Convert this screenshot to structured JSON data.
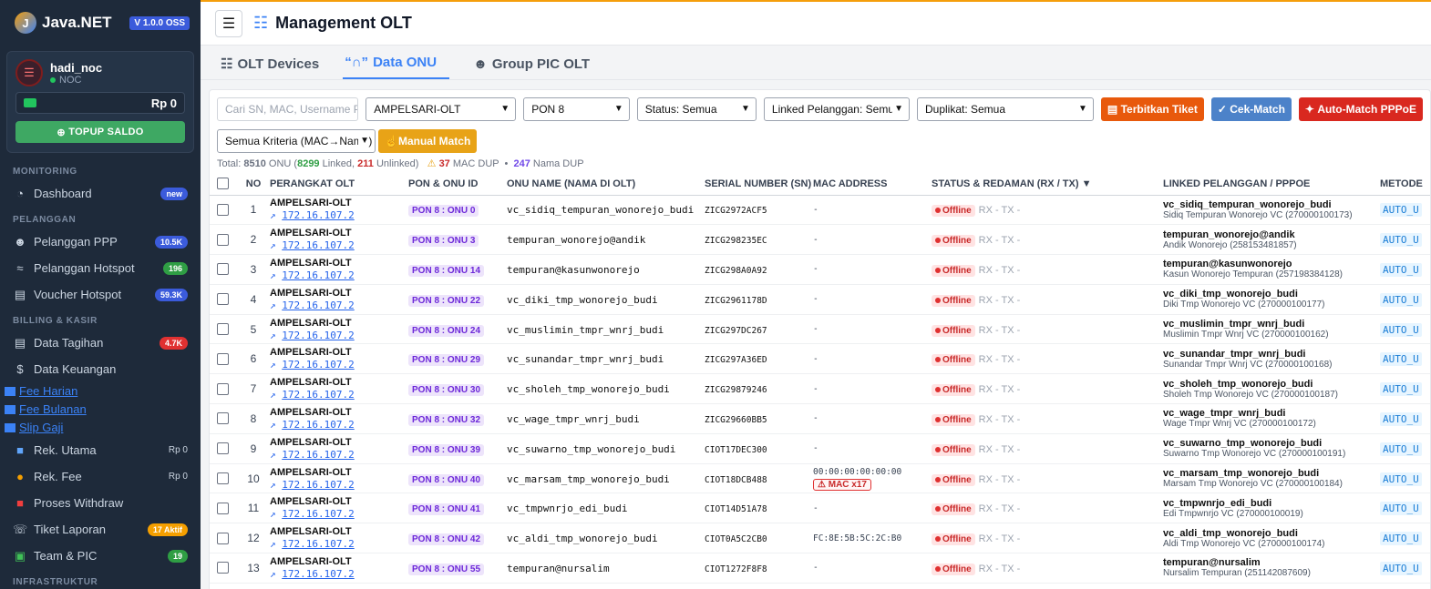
{
  "brand": {
    "name": "Java.NET",
    "version": "V 1.0.0 OSS"
  },
  "user": {
    "name": "hadi_noc",
    "role": "NOC",
    "saldo": "Rp 0",
    "topup_label": "TOPUP SALDO"
  },
  "sidebar": {
    "sections": {
      "monitoring": "MONITORING",
      "pelanggan": "PELANGGAN",
      "billing": "BILLING & KASIR",
      "infra": "INFRASTRUKTUR"
    },
    "items": {
      "dashboard": {
        "label": "Dashboard",
        "badge": "new"
      },
      "ppp": {
        "label": "Pelanggan PPP",
        "badge": "10.5K"
      },
      "hotspot": {
        "label": "Pelanggan Hotspot",
        "badge": "196"
      },
      "voucher": {
        "label": "Voucher Hotspot",
        "badge": "59.3K"
      },
      "tagihan": {
        "label": "Data Tagihan",
        "badge": "4.7K"
      },
      "keuangan": {
        "label": "Data Keuangan"
      },
      "fee_harian": {
        "label": "Fee Harian"
      },
      "fee_bulanan": {
        "label": "Fee Bulanan"
      },
      "slip_gaji": {
        "label": "Slip Gaji"
      },
      "rek_utama": {
        "label": "Rek. Utama",
        "badge": "Rp 0"
      },
      "rek_fee": {
        "label": "Rek. Fee",
        "badge": "Rp 0"
      },
      "withdraw": {
        "label": "Proses Withdraw"
      },
      "tiket": {
        "label": "Tiket Laporan",
        "badge": "17 Aktif"
      },
      "team": {
        "label": "Team & PIC",
        "badge": "19"
      }
    }
  },
  "header": {
    "title": "Management OLT"
  },
  "tabs": {
    "olt": "OLT Devices",
    "onu": "Data ONU",
    "group": "Group PIC OLT"
  },
  "filters": {
    "search_placeholder": "Cari SN, MAC, Username PPPoE",
    "olt": "AMPELSARI-OLT",
    "pon": "PON 8",
    "status": "Status: Semua",
    "linked": "Linked Pelanggan: Semua",
    "duplikat": "Duplikat: Semua",
    "kriteria": "Semua Kriteria (MAC→Nama)",
    "btn_tiket": "Terbitkan Tiket",
    "btn_cek": "Cek-Match",
    "btn_auto": "Auto-Match PPPoE",
    "btn_manual": "Manual Match"
  },
  "summary": {
    "total_label": "Total:",
    "total": "8510",
    "onu_word": "ONU (",
    "linked": "8299",
    "linked_word": "Linked,",
    "unlinked": "211",
    "unlinked_word": "Unlinked)",
    "mac_dup": "37",
    "mac_dup_word": "MAC DUP",
    "nama_dup": "247",
    "nama_dup_word": "Nama DUP"
  },
  "columns": {
    "no": "NO",
    "perangkat": "PERANGKAT OLT",
    "pon": "PON & ONU ID",
    "onu_name": "ONU NAME (NAMA DI OLT)",
    "sn": "SERIAL NUMBER (SN)",
    "mac": "MAC ADDRESS",
    "status": "STATUS & REDAMAN (RX / TX) ▼",
    "linked": "LINKED PELANGGAN / PPPOE",
    "metode": "METODE"
  },
  "rows": [
    {
      "no": "1",
      "olt": "AMPELSARI-OLT",
      "ip": "172.16.107.2",
      "pon": "PON 8 : ONU 0",
      "name": "vc_sidiq_tempuran_wonorejo_budi",
      "sn": "ZICG2972ACF5",
      "mac": "-",
      "dup": "",
      "status": "Offline",
      "rx": "RX -  TX -",
      "user": "vc_sidiq_tempuran_wonorejo_budi",
      "sub": "Sidiq Tempuran Wonorejo VC (270000100173)",
      "metode": "AUTO_U"
    },
    {
      "no": "2",
      "olt": "AMPELSARI-OLT",
      "ip": "172.16.107.2",
      "pon": "PON 8 : ONU 3",
      "name": "tempuran_wonorejo@andik",
      "sn": "ZICG298235EC",
      "mac": "-",
      "dup": "",
      "status": "Offline",
      "rx": "RX -  TX -",
      "user": "tempuran_wonorejo@andik",
      "sub": "Andik Wonorejo (258153481857)",
      "metode": "AUTO_U"
    },
    {
      "no": "3",
      "olt": "AMPELSARI-OLT",
      "ip": "172.16.107.2",
      "pon": "PON 8 : ONU 14",
      "name": "tempuran@kasunwonorejo",
      "sn": "ZICG298A0A92",
      "mac": "-",
      "dup": "",
      "status": "Offline",
      "rx": "RX -  TX -",
      "user": "tempuran@kasunwonorejo",
      "sub": "Kasun Wonorejo Tempuran (257198384128)",
      "metode": "AUTO_U"
    },
    {
      "no": "4",
      "olt": "AMPELSARI-OLT",
      "ip": "172.16.107.2",
      "pon": "PON 8 : ONU 22",
      "name": "vc_diki_tmp_wonorejo_budi",
      "sn": "ZICG2961178D",
      "mac": "-",
      "dup": "",
      "status": "Offline",
      "rx": "RX -  TX -",
      "user": "vc_diki_tmp_wonorejo_budi",
      "sub": "Diki Tmp Wonorejo VC (270000100177)",
      "metode": "AUTO_U"
    },
    {
      "no": "5",
      "olt": "AMPELSARI-OLT",
      "ip": "172.16.107.2",
      "pon": "PON 8 : ONU 24",
      "name": "vc_muslimin_tmpr_wnrj_budi",
      "sn": "ZICG297DC267",
      "mac": "-",
      "dup": "",
      "status": "Offline",
      "rx": "RX -  TX -",
      "user": "vc_muslimin_tmpr_wnrj_budi",
      "sub": "Muslimin Tmpr Wnrj VC (270000100162)",
      "metode": "AUTO_U"
    },
    {
      "no": "6",
      "olt": "AMPELSARI-OLT",
      "ip": "172.16.107.2",
      "pon": "PON 8 : ONU 29",
      "name": "vc_sunandar_tmpr_wnrj_budi",
      "sn": "ZICG297A36ED",
      "mac": "-",
      "dup": "",
      "status": "Offline",
      "rx": "RX -  TX -",
      "user": "vc_sunandar_tmpr_wnrj_budi",
      "sub": "Sunandar Tmpr Wnrj VC (270000100168)",
      "metode": "AUTO_U"
    },
    {
      "no": "7",
      "olt": "AMPELSARI-OLT",
      "ip": "172.16.107.2",
      "pon": "PON 8 : ONU 30",
      "name": "vc_sholeh_tmp_wonorejo_budi",
      "sn": "ZICG29879246",
      "mac": "-",
      "dup": "",
      "status": "Offline",
      "rx": "RX -  TX -",
      "user": "vc_sholeh_tmp_wonorejo_budi",
      "sub": "Sholeh Tmp Wonorejo VC (270000100187)",
      "metode": "AUTO_U"
    },
    {
      "no": "8",
      "olt": "AMPELSARI-OLT",
      "ip": "172.16.107.2",
      "pon": "PON 8 : ONU 32",
      "name": "vc_wage_tmpr_wnrj_budi",
      "sn": "ZICG29660BB5",
      "mac": "-",
      "dup": "",
      "status": "Offline",
      "rx": "RX -  TX -",
      "user": "vc_wage_tmpr_wnrj_budi",
      "sub": "Wage Tmpr Wnrj VC (270000100172)",
      "metode": "AUTO_U"
    },
    {
      "no": "9",
      "olt": "AMPELSARI-OLT",
      "ip": "172.16.107.2",
      "pon": "PON 8 : ONU 39",
      "name": "vc_suwarno_tmp_wonorejo_budi",
      "sn": "CIOT17DEC300",
      "mac": "-",
      "dup": "",
      "status": "Offline",
      "rx": "RX -  TX -",
      "user": "vc_suwarno_tmp_wonorejo_budi",
      "sub": "Suwarno Tmp Wonorejo VC (270000100191)",
      "metode": "AUTO_U"
    },
    {
      "no": "10",
      "olt": "AMPELSARI-OLT",
      "ip": "172.16.107.2",
      "pon": "PON 8 : ONU 40",
      "name": "vc_marsam_tmp_wonorejo_budi",
      "sn": "CIOT18DCB488",
      "mac": "00:00:00:00:00:00",
      "dup": "⚠ MAC x17",
      "status": "Offline",
      "rx": "RX -  TX -",
      "user": "vc_marsam_tmp_wonorejo_budi",
      "sub": "Marsam Tmp Wonorejo VC (270000100184)",
      "metode": "AUTO_U"
    },
    {
      "no": "11",
      "olt": "AMPELSARI-OLT",
      "ip": "172.16.107.2",
      "pon": "PON 8 : ONU 41",
      "name": "vc_tmpwnrjo_edi_budi",
      "sn": "CIOT14D51A78",
      "mac": "-",
      "dup": "",
      "status": "Offline",
      "rx": "RX -  TX -",
      "user": "vc_tmpwnrjo_edi_budi",
      "sub": "Edi Tmpwnrjo VC (270000100019)",
      "metode": "AUTO_U"
    },
    {
      "no": "12",
      "olt": "AMPELSARI-OLT",
      "ip": "172.16.107.2",
      "pon": "PON 8 : ONU 42",
      "name": "vc_aldi_tmp_wonorejo_budi",
      "sn": "CIOT0A5C2CB0",
      "mac": "FC:8E:5B:5C:2C:B0",
      "dup": "",
      "status": "Offline",
      "rx": "RX -  TX -",
      "user": "vc_aldi_tmp_wonorejo_budi",
      "sub": "Aldi Tmp Wonorejo VC (270000100174)",
      "metode": "AUTO_U"
    },
    {
      "no": "13",
      "olt": "AMPELSARI-OLT",
      "ip": "172.16.107.2",
      "pon": "PON 8 : ONU 55",
      "name": "tempuran@nursalim",
      "sn": "CIOT1272F8F8",
      "mac": "-",
      "dup": "",
      "status": "Offline",
      "rx": "RX -  TX -",
      "user": "tempuran@nursalim",
      "sub": "Nursalim Tempuran (251142087609)",
      "metode": "AUTO_U"
    }
  ]
}
